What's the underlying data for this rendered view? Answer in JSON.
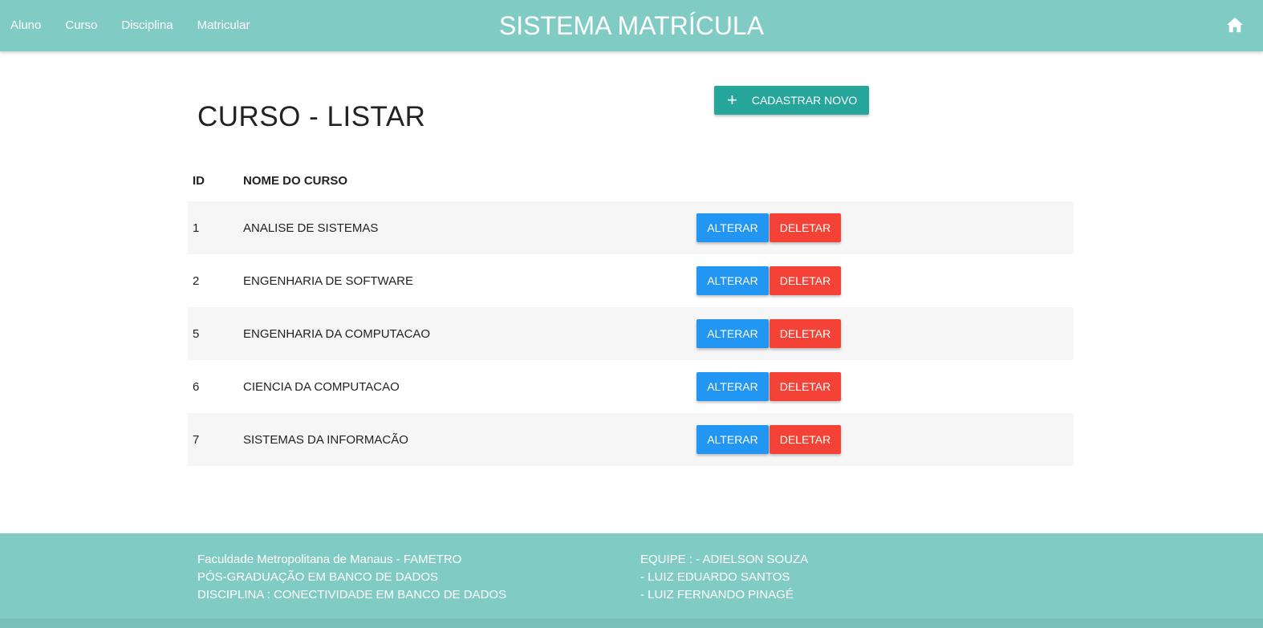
{
  "nav": {
    "items": [
      {
        "label": "Aluno"
      },
      {
        "label": "Curso"
      },
      {
        "label": "Disciplina"
      },
      {
        "label": "Matricular"
      }
    ],
    "brand": "SISTEMA MATRÍCULA",
    "home_icon": "home-icon"
  },
  "page": {
    "title": "CURSO - LISTAR",
    "new_button": "CADASTRAR NOVO",
    "new_button_icon": "+"
  },
  "table": {
    "headers": {
      "id": "ID",
      "name": "NOME DO CURSO"
    },
    "rows": [
      {
        "id": "1",
        "name": "ANALISE DE SISTEMAS",
        "edit": "ALTERAR",
        "delete": "DELETAR"
      },
      {
        "id": "2",
        "name": "ENGENHARIA DE SOFTWARE",
        "edit": "ALTERAR",
        "delete": "DELETAR"
      },
      {
        "id": "5",
        "name": "ENGENHARIA DA COMPUTACAO",
        "edit": "ALTERAR",
        "delete": "DELETAR"
      },
      {
        "id": "6",
        "name": "CIENCIA DA COMPUTACAO",
        "edit": "ALTERAR",
        "delete": "DELETAR"
      },
      {
        "id": "7",
        "name": "SISTEMAS DA INFORMACÃO",
        "edit": "ALTERAR",
        "delete": "DELETAR"
      }
    ]
  },
  "footer": {
    "left": [
      "Faculdade Metropolitana de Manaus - FAMETRO",
      "PÓS-GRADUAÇÃO EM BANCO DE DADOS",
      "DISCIPLINA : CONECTIVIDADE EM BANCO DE DADOS"
    ],
    "right": [
      "EQUIPE : - ADIELSON SOUZA",
      "- LUIZ EDUARDO SANTOS",
      "- LUIZ FERNANDO PINAGÉ"
    ]
  },
  "colors": {
    "header_bg": "#80cbc4",
    "new_button": "#26a69a",
    "edit_button": "#2196f3",
    "delete_button": "#f44336"
  }
}
